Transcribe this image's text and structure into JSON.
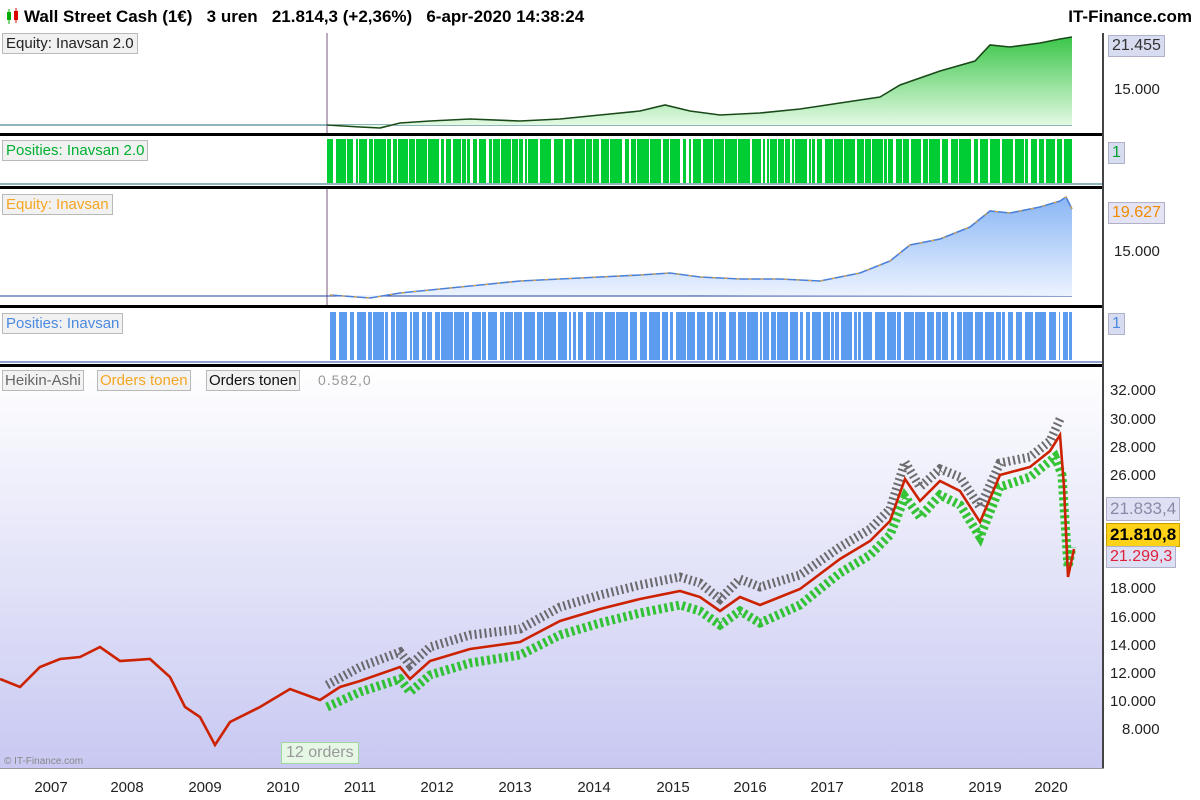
{
  "header": {
    "title": "Wall Street Cash (1€)   3 uren   21.814,3 (+2,36%)   6-apr-2020 14:38:24",
    "brand": "IT-Finance.com"
  },
  "panels": {
    "equity1": {
      "label": "Equity: Inavsan 2.0",
      "value": "21.455",
      "tick": "15.000",
      "color": "#2aa02a"
    },
    "positions1": {
      "label": "Posities: Inavsan 2.0",
      "value": "1",
      "color": "#00cc33"
    },
    "equity2": {
      "label": "Equity: Inavsan",
      "value": "19.627",
      "tick": "15.000",
      "color": "#f5a623"
    },
    "positions2": {
      "label": "Posities: Inavsan",
      "value": "1",
      "color": "#5b9cf0"
    }
  },
  "price": {
    "tabs": [
      "Heikin-Ashi",
      "Orders tonen",
      "Orders tonen"
    ],
    "first_value": "0.582,0",
    "ticks": [
      "32.000",
      "30.000",
      "28.000",
      "26.000",
      "18.000",
      "16.000",
      "14.000",
      "12.000",
      "10.000",
      "8.000"
    ],
    "badges": {
      "top": "21.833,4",
      "mid": "21.810,8",
      "low": "21.299,3"
    },
    "orders_badge": "12 orders",
    "copyright": "© IT-Finance.com",
    "colors": {
      "line": "#cc2200",
      "buy": "#00bb22",
      "sell": "#444444",
      "badge_mid": "#ffd21a",
      "badge_low": "#e0203a"
    }
  },
  "xaxis": {
    "years": [
      "2007",
      "2008",
      "2009",
      "2010",
      "2011",
      "2012",
      "2013",
      "2014",
      "2015",
      "2016",
      "2017",
      "2018",
      "2019",
      "2020"
    ]
  }
}
